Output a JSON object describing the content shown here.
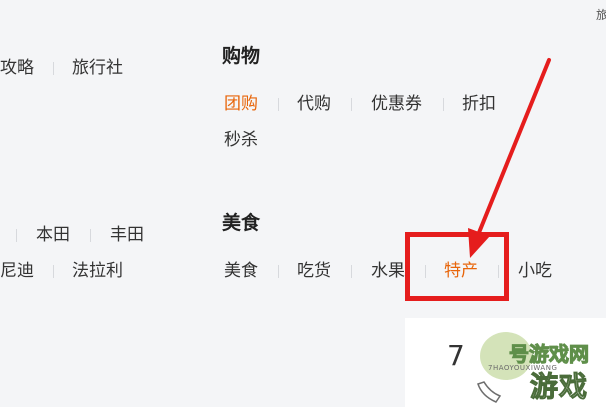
{
  "edge_char": "旅",
  "left_column": {
    "row1": [
      "攻略",
      "旅行社"
    ],
    "row2": [
      "本田",
      "丰田"
    ],
    "row3": [
      "尼迪",
      "法拉利"
    ]
  },
  "shopping": {
    "heading": "购物",
    "items": [
      {
        "label": "团购",
        "active": true
      },
      {
        "label": "代购",
        "active": false
      },
      {
        "label": "优惠券",
        "active": false
      },
      {
        "label": "折扣",
        "active": false
      },
      {
        "label": "秒杀",
        "active": false
      }
    ]
  },
  "food": {
    "heading": "美食",
    "items": [
      {
        "label": "美食",
        "active": false
      },
      {
        "label": "吃货",
        "active": false
      },
      {
        "label": "水果",
        "active": false
      },
      {
        "label": "特产",
        "active": true
      },
      {
        "label": "小吃",
        "active": false
      }
    ]
  },
  "card": {
    "number": "7"
  },
  "watermark": {
    "top": "号游戏网",
    "main": "游戏",
    "sub": "7HAOYOUXIWANG"
  },
  "colors": {
    "background": "#f4f5f7",
    "text": "#333333",
    "active": "#e8650a",
    "annotation_red": "#e51d1d"
  }
}
